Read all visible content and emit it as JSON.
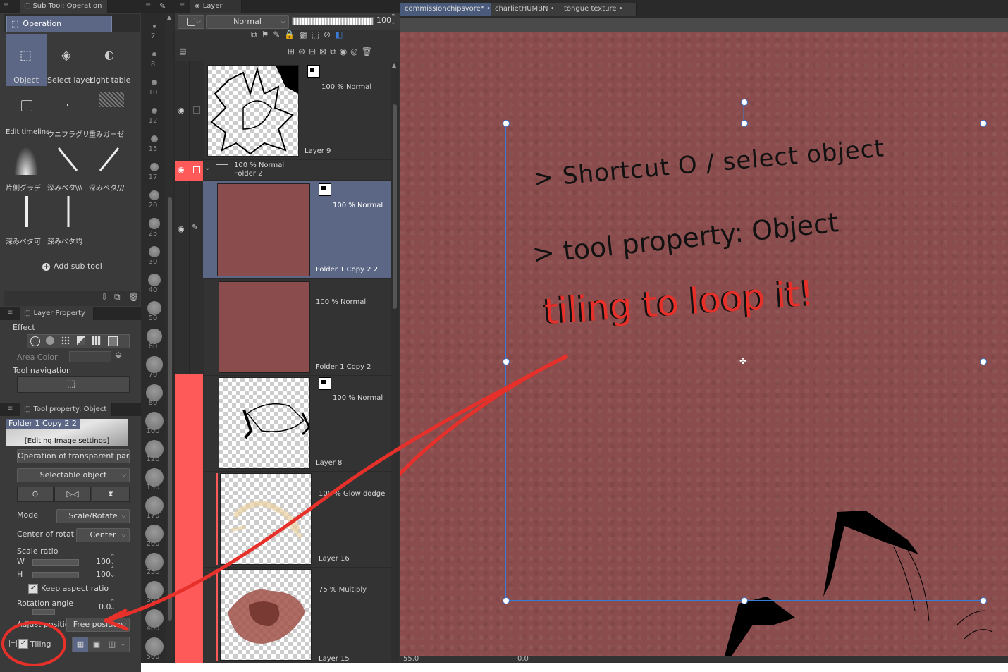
{
  "subtool_panel": {
    "tab_label": "Sub Tool: Operation",
    "group_label": "Operation",
    "tools": [
      {
        "label": "Object",
        "icon": "object-arrow-icon"
      },
      {
        "label": "Select layer",
        "icon": "select-layer-icon"
      },
      {
        "label": "Light table",
        "icon": "light-table-icon"
      },
      {
        "label": "Edit timeline",
        "icon": "edit-timeline-icon"
      },
      {
        "label": "ウニフラグリッ",
        "icon": "dot-icon"
      },
      {
        "label": "重みガーゼ",
        "icon": "gauze-icon"
      },
      {
        "label": "片側グラデ",
        "icon": "gradient-icon"
      },
      {
        "label": "深みベタ\\\\\\",
        "icon": "diagonal-line-icon"
      },
      {
        "label": "深みベタ///",
        "icon": "diagonal-line-icon"
      },
      {
        "label": "深みベタ可",
        "icon": "vertical-line-icon"
      },
      {
        "label": "深みベタ均",
        "icon": "vertical-line-icon"
      }
    ],
    "add_subtool_label": "Add sub tool"
  },
  "layer_property": {
    "tab_label": "Layer Property",
    "effect_label": "Effect",
    "area_color_label": "Area Color",
    "tool_navigation_label": "Tool navigation"
  },
  "tool_property": {
    "tab_label": "Tool property: Object",
    "preview_name": "Folder 1 Copy 2 2",
    "preview_caption": "[Editing Image settings]",
    "transparent_select": "Operation of transparent part",
    "selectable_select": "Selectable object",
    "mode_label": "Mode",
    "mode_value": "Scale/Rotate",
    "center_label": "Center of rotation",
    "center_value": "Center",
    "scale_ratio_label": "Scale ratio",
    "w_label": "W",
    "w_value": "100",
    "h_label": "H",
    "h_value": "100",
    "keep_aspect_label": "Keep aspect ratio",
    "keep_aspect_checked": true,
    "rotation_label": "Rotation angle",
    "rotation_value": "0.0",
    "adjust_label": "Adjust position",
    "adjust_value": "Free position",
    "tiling_label": "Tiling",
    "tiling_checked": true
  },
  "brush_sizes": [
    "7",
    "8",
    "10",
    "12",
    "15",
    "17",
    "20",
    "25",
    "30",
    "40",
    "50",
    "60",
    "70",
    "80",
    "100",
    "120",
    "150",
    "170",
    "200",
    "250",
    "300",
    "400",
    "500"
  ],
  "layer_panel": {
    "tab_label": "Layer",
    "blend_mode": "Normal",
    "opacity": "100",
    "layers": [
      {
        "name": "Layer 9",
        "info": "100 % Normal",
        "thumb": "sketch"
      },
      {
        "name": "Folder 2",
        "info": "100 % Normal",
        "thumb": "folder"
      },
      {
        "name": "Folder 1 Copy 2 2",
        "info": "100 % Normal",
        "thumb": "texture",
        "selected": true
      },
      {
        "name": "Folder 1 Copy 2",
        "info": "100 % Normal",
        "thumb": "texture"
      },
      {
        "name": "Layer 8",
        "info": "100 % Normal",
        "thumb": "sketch2"
      },
      {
        "name": "Layer 16",
        "info": "100 % Glow dodge",
        "thumb": "glow"
      },
      {
        "name": "Layer 15",
        "info": "75 % Multiply",
        "thumb": "multiply"
      }
    ]
  },
  "canvas_tabs": [
    "commissionchipsvore*",
    "charlietHUMBN",
    "tongue texture"
  ],
  "canvas": {
    "bg_color": "#8a4c4c",
    "annotation_lines": [
      "> Shortcut O / select object",
      "> tool property: Object",
      "tiling to loop it!"
    ],
    "status_zoom": "55.0",
    "status_angle": "0.0"
  },
  "colors": {
    "accent_red": "#e8302a",
    "selection_blue": "#3a7bd5",
    "selected_layer": "#5b6785",
    "layer_marker_red": "#ff5a5a"
  }
}
